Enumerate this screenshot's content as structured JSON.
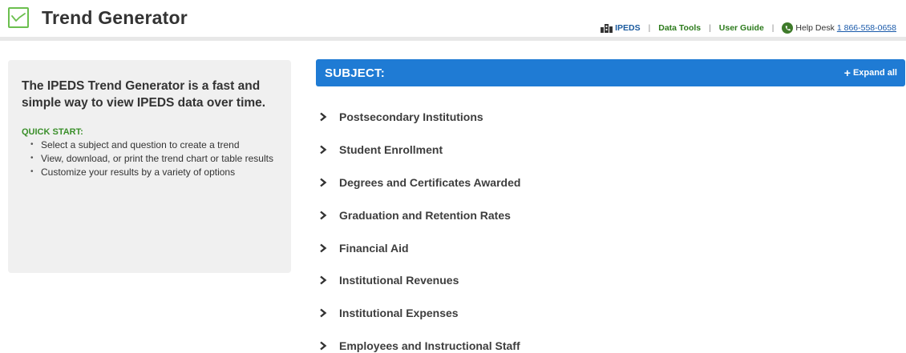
{
  "header": {
    "title": "Trend Generator",
    "links": {
      "ipeds": "IPEDS",
      "data_tools": "Data Tools",
      "user_guide": "User Guide",
      "help_desk": "Help Desk",
      "phone": "1 866-558-0658",
      "separator": "|"
    }
  },
  "intro": {
    "text": "The IPEDS Trend Generator is a fast and simple way to view IPEDS data over time.",
    "quick_start_title": "QUICK START:",
    "steps": [
      "Select a subject and question to create a trend",
      "View, download, or print the trend chart or table results",
      "Customize your results by a variety of options"
    ]
  },
  "subject": {
    "title": "SUBJECT:",
    "expand_label": "Expand all",
    "items": [
      "Postsecondary Institutions",
      "Student Enrollment",
      "Degrees and Certificates Awarded",
      "Graduation and Retention Rates",
      "Financial Aid",
      "Institutional Revenues",
      "Institutional Expenses",
      "Employees and Instructional Staff"
    ]
  },
  "colors": {
    "accent_blue": "#1f7bd4",
    "accent_green": "#3a8f2a",
    "panel_gray": "#f0f0f0"
  },
  "icons": {
    "logo": "trend-line-icon",
    "ipeds": "building-icon",
    "help": "phone-icon",
    "expand": "plus-icon",
    "item": "chevron-right-icon"
  }
}
